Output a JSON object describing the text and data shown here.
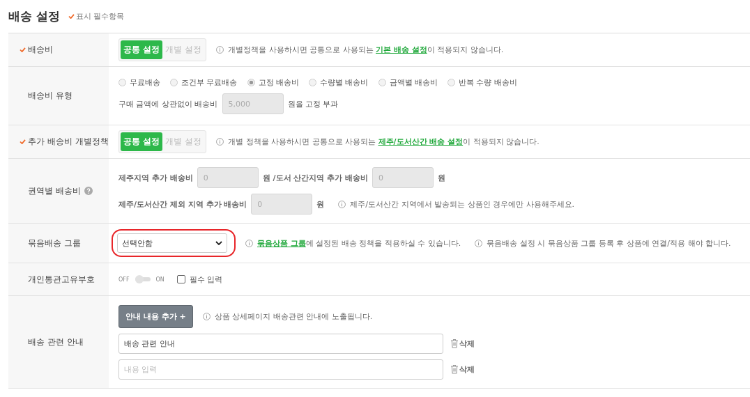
{
  "title": "배송 설정",
  "required_legend": "표시 필수항목",
  "rows": [
    {
      "kind": "segmented",
      "label": "배송비",
      "required": true,
      "options": [
        {
          "label": "공통 설정",
          "selected": true
        },
        {
          "label": "개별 설정",
          "selected": false
        }
      ],
      "notes": [
        {
          "before": "개별정책을 사용하시면 공통으로 사용되는 ",
          "link": "기본 배송 설정",
          "after": "이 적용되지 않습니다."
        }
      ]
    },
    {
      "kind": "radio",
      "label": "배송비 유형",
      "required": false,
      "options": [
        {
          "label": "무료배송",
          "selected": false
        },
        {
          "label": "조건부 무료배송",
          "selected": false
        },
        {
          "label": "고정 배송비",
          "selected": true
        },
        {
          "label": "수량별 배송비",
          "selected": false
        },
        {
          "label": "금액별 배송비",
          "selected": false
        },
        {
          "label": "반복 수량 배송비",
          "selected": false
        }
      ],
      "disabled": true,
      "prefix": "구매 금액에 상관없이 배송비",
      "value": "5,000",
      "suffix": "원을 고정 부과"
    },
    {
      "kind": "segmented",
      "label": "추가 배송비 개별정책",
      "required": true,
      "options": [
        {
          "label": "공통 설정",
          "selected": true
        },
        {
          "label": "개별 설정",
          "selected": false
        }
      ],
      "notes": [
        {
          "before": "개별 정책을 사용하시면 공통으로 사용되는 ",
          "link": "제주/도서산간 배송 설정",
          "after": "이 적용되지 않습니다."
        }
      ]
    },
    {
      "kind": "regional",
      "label": "권역별 배송비",
      "required": false,
      "help": true,
      "lines": [
        {
          "parts": [
            {
              "kind": "text",
              "text": "제주지역 추가 배송비"
            },
            {
              "kind": "input",
              "value": "0"
            },
            {
              "kind": "text",
              "text": "원 /도서 산간지역 추가 배송비"
            },
            {
              "kind": "input",
              "value": "0"
            },
            {
              "kind": "text",
              "text": "원"
            }
          ]
        },
        {
          "parts": [
            {
              "kind": "text",
              "text": "제주/도서산간 제외 지역 추가 배송비"
            },
            {
              "kind": "input",
              "value": "0"
            },
            {
              "kind": "text",
              "text": "원"
            },
            {
              "kind": "note",
              "text": "제주/도서산간 지역에서 발송되는 상품인 경우에만 사용해주세요."
            }
          ]
        }
      ]
    },
    {
      "kind": "select",
      "label": "묶음배송 그룹",
      "required": false,
      "value": "선택안함",
      "highlighted": true,
      "notes": [
        {
          "link": "묶음상품 그룹",
          "after": "에 설정된 배송 정책을 적용하실 수 있습니다."
        },
        {
          "before": "묶음배송 설정 시 묶음상품 그룹 등록 후 상품에 연결/적용 해야 합니다."
        }
      ]
    },
    {
      "kind": "toggle",
      "label": "개인통관고유부호",
      "required": false,
      "off_label": "OFF",
      "on_label": "ON",
      "on": false,
      "checkbox": {
        "label": "필수 입력",
        "checked": false
      }
    },
    {
      "kind": "guide",
      "label": "배송 관련 안내",
      "required": false,
      "button": "안내 내용 추가 +",
      "note": "상품 상세페이지 배송관련 안내에 노출됩니다.",
      "entries": [
        {
          "value": "배송 관련 안내",
          "delete": "삭제"
        },
        {
          "placeholder": "내용 입력",
          "delete": "삭제"
        }
      ]
    }
  ]
}
